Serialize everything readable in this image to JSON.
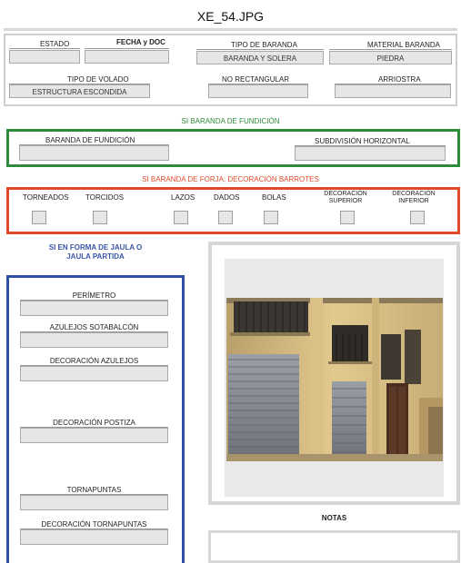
{
  "title": "XE_54.JPG",
  "general": {
    "estado_label": "ESTADO",
    "fecha_label": "FECHA y DOC",
    "tipo_baranda_label": "TIPO DE BARANDA",
    "tipo_baranda_value": "BARANDA Y SOLERA",
    "material_label": "MATERIAL BARANDA",
    "material_value": "PIEDRA",
    "tipo_volado_label": "TIPO DE VOLADO",
    "tipo_volado_value": "ESTRUCTURA ESCONDIDA",
    "rectangular_label": "NO RECTANGULAR",
    "arriostra_label": "ARRIOSTRA"
  },
  "fundicion": {
    "section_title": "SI BARANDA DE FUNDICIÓN",
    "baranda_label": "BARANDA DE FUNDICIÓN",
    "subdivision_label": "SUBDIVISIÓN HORIZONTAL"
  },
  "forja": {
    "section_title": "SI BARANDA DE FORJA: DECORACIÓN BARROTES",
    "torneados": "TORNEADOS",
    "torcidos": "TORCIDOS",
    "lazos": "LAZOS",
    "dados": "DADOS",
    "bolas": "BOLAS",
    "dec_sup_1": "DECORACIÓN",
    "dec_sup_2": "SUPERIOR",
    "dec_inf_1": "DECORACIÓN",
    "dec_inf_2": "INFERIOR"
  },
  "jaula": {
    "title_1": "SI EN FORMA DE JAULA O",
    "title_2": "JAULA PARTIDA",
    "perimetro": "PERÍMETRO",
    "azulejos": "AZULEJOS SOTABALCÓN",
    "dec_azulejos": "DECORACIÓN AZULEJOS",
    "dec_postiza": "DECORACIÓN POSTIZA",
    "tornapuntas": "TORNAPUNTAS",
    "dec_tornapuntas": "DECORACIÓN TORNAPUNTAS"
  },
  "notes": {
    "label": "NOTAS"
  },
  "photo": {
    "icon": "building-facade-photo"
  },
  "colors": {
    "green": "#2e8b3a",
    "red": "#e04a2a",
    "blue": "#2d4fa5",
    "field": "#e6e6e6"
  }
}
